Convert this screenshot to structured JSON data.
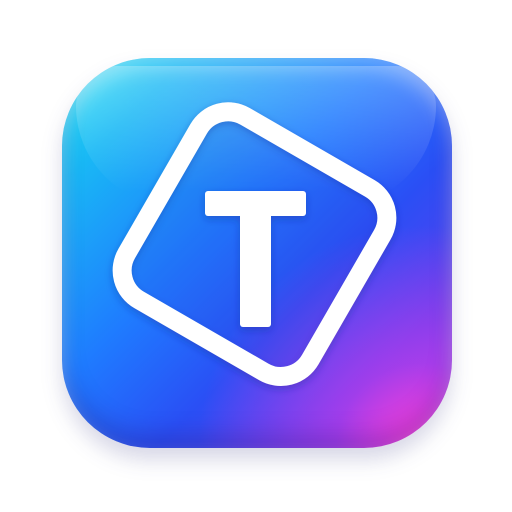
{
  "icon": {
    "name": "app-icon",
    "glyph": "letter-t-icon",
    "letter": "T",
    "colors": {
      "gradient_start": "#2fe6f2",
      "gradient_mid": "#1f7bff",
      "gradient_end": "#8a3cf0",
      "accent_corner": "#ff3fd6",
      "foreground": "#ffffff",
      "background": "#ffffff"
    }
  }
}
